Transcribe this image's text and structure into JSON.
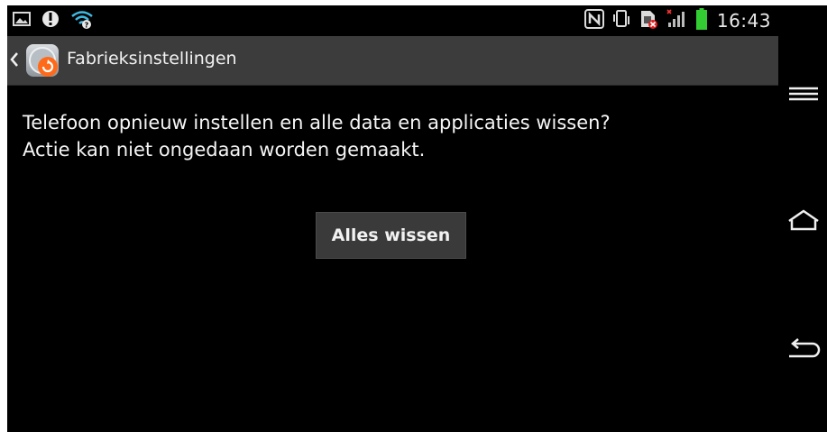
{
  "status_bar": {
    "time": "16:43",
    "left_icons": [
      "image-notification-icon",
      "alert-notification-icon",
      "wifi-question-icon"
    ],
    "right_icons": [
      "nfc-icon",
      "vibrate-icon",
      "no-sim-icon",
      "signal-icon",
      "battery-icon"
    ]
  },
  "action_bar": {
    "title": "Fabrieksinstellingen",
    "icon": "factory-reset-app-icon",
    "accent_color": "#ff6a1a"
  },
  "main": {
    "message_line1": "Telefoon opnieuw instellen en alle data en applicaties wissen?",
    "message_line2": "Actie kan niet ongedaan worden gemaakt.",
    "button_label": "Alles wissen"
  },
  "nav_bar": {
    "buttons": [
      "menu-icon",
      "home-icon",
      "back-icon"
    ]
  },
  "colors": {
    "background": "#000000",
    "action_bar": "#3c3c3c",
    "button": "#3a3a3a",
    "battery": "#33cc33",
    "signal_alert": "#ff3333"
  }
}
